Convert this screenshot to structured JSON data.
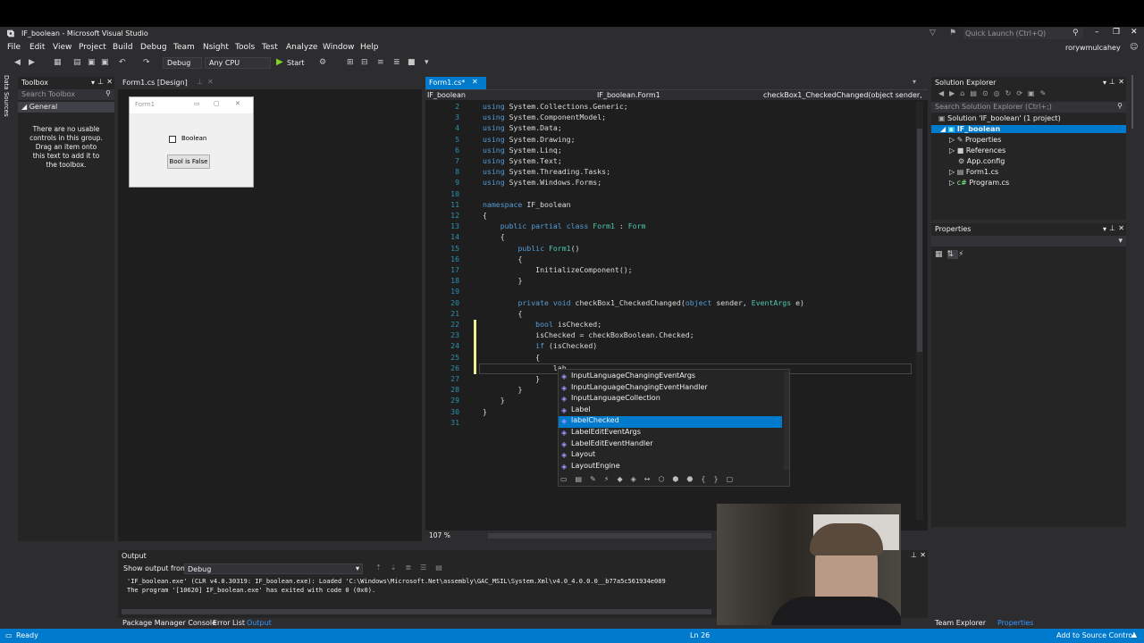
{
  "window": {
    "title": "IF_boolean - Microsoft Visual Studio",
    "quick_launch": "Quick Launch (Ctrl+Q)",
    "user": "rorywmulcahey"
  },
  "menu": [
    "File",
    "Edit",
    "View",
    "Project",
    "Build",
    "Debug",
    "Team",
    "Nsight",
    "Tools",
    "Test",
    "Analyze",
    "Window",
    "Help"
  ],
  "toolbar": {
    "config": "Debug",
    "platform": "Any CPU",
    "start": "Start"
  },
  "toolbox": {
    "title": "Toolbox",
    "search": "Search Toolbox",
    "group": "General",
    "empty_msg": "There are no usable controls in this group. Drag an item onto this text to add it to the toolbox.",
    "side_tab": "Data Sources"
  },
  "designer": {
    "tab": "Form1.cs [Design]",
    "form_title": "Form1",
    "checkbox_label": "Boolean",
    "button_label": "Bool is False"
  },
  "editor": {
    "tab": "Form1.cs*",
    "nav_project": "IF_boolean",
    "nav_class": "IF_boolean.Form1",
    "nav_member": "checkBox1_CheckedChanged(object sender, E",
    "zoom": "107 %",
    "lines": [
      {
        "n": "2",
        "t": "using System.Collections.Generic;"
      },
      {
        "n": "3",
        "t": "using System.ComponentModel;"
      },
      {
        "n": "4",
        "t": "using System.Data;"
      },
      {
        "n": "5",
        "t": "using System.Drawing;"
      },
      {
        "n": "6",
        "t": "using System.Linq;"
      },
      {
        "n": "7",
        "t": "using System.Text;"
      },
      {
        "n": "8",
        "t": "using System.Threading.Tasks;"
      },
      {
        "n": "9",
        "t": "using System.Windows.Forms;"
      },
      {
        "n": "10",
        "t": ""
      },
      {
        "n": "11",
        "t": "namespace IF_boolean"
      },
      {
        "n": "12",
        "t": "{"
      },
      {
        "n": "13",
        "t": "    public partial class Form1 : Form"
      },
      {
        "n": "14",
        "t": "    {"
      },
      {
        "n": "15",
        "t": "        public Form1()"
      },
      {
        "n": "16",
        "t": "        {"
      },
      {
        "n": "17",
        "t": "            InitializeComponent();"
      },
      {
        "n": "18",
        "t": "        }"
      },
      {
        "n": "19",
        "t": ""
      },
      {
        "n": "20",
        "t": "        private void checkBox1_CheckedChanged(object sender, EventArgs e)"
      },
      {
        "n": "21",
        "t": "        {"
      },
      {
        "n": "22",
        "t": "            bool isChecked;"
      },
      {
        "n": "23",
        "t": "            isChecked = checkBoxBoolean.Checked;"
      },
      {
        "n": "24",
        "t": "            if (isChecked)"
      },
      {
        "n": "25",
        "t": "            {"
      },
      {
        "n": "26",
        "t": "                lab"
      },
      {
        "n": "27",
        "t": "            }"
      },
      {
        "n": "28",
        "t": "        }"
      },
      {
        "n": "29",
        "t": "    }"
      },
      {
        "n": "30",
        "t": "}"
      },
      {
        "n": "31",
        "t": ""
      }
    ]
  },
  "autocomplete": {
    "items": [
      "InputLanguageChangingEventArgs",
      "InputLanguageChangingEventHandler",
      "InputLanguageCollection",
      "Label",
      "labelChecked",
      "LabelEditEventArgs",
      "LabelEditEventHandler",
      "Layout",
      "LayoutEngine"
    ],
    "selected": "labelChecked"
  },
  "solution": {
    "title": "Solution Explorer",
    "search": "Search Solution Explorer (Ctrl+;)",
    "root": "Solution 'IF_boolean' (1 project)",
    "project": "IF_boolean",
    "items": [
      "Properties",
      "References",
      "App.config",
      "Form1.cs",
      "Program.cs"
    ]
  },
  "properties": {
    "title": "Properties"
  },
  "output": {
    "title": "Output",
    "show_from_label": "Show output from:",
    "show_from": "Debug",
    "lines": [
      "'IF_boolean.exe' (CLR v4.0.30319: IF_boolean.exe): Loaded 'C:\\Windows\\Microsoft.Net\\assembly\\GAC_MSIL\\System.Xml\\v4.0_4.0.0.0__b77a5c561934e089",
      "The program '[10620] IF_boolean.exe' has exited with code 0 (0x0)."
    ]
  },
  "bottom_tabs": [
    "Package Manager Console",
    "Error List",
    "Output"
  ],
  "right_bottom_tabs": [
    "Team Explorer",
    "Properties"
  ],
  "status": {
    "ready": "Ready",
    "ln": "Ln 26",
    "source_control": "Add to Source Control"
  }
}
